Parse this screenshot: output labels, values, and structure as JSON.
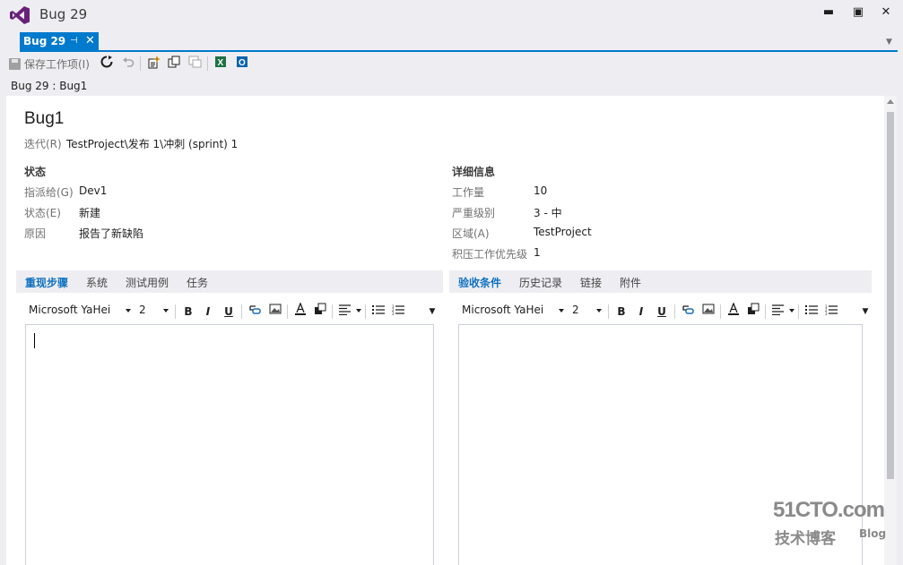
{
  "window": {
    "title": "Bug 29",
    "minimize": "▬",
    "maximize": "▣",
    "close": "✕"
  },
  "tab": {
    "label": "Bug 29",
    "pin": "⊣",
    "close": "✕",
    "overflow": "▼"
  },
  "toolbar": {
    "save_label": "保存工作项(I)",
    "icons": [
      "save-icon",
      "refresh-icon",
      "undo-icon",
      "new-linked-icon",
      "copy-icon",
      "email-icon",
      "excel-icon",
      "outlook-icon"
    ]
  },
  "breadcrumb": "Bug 29 : Bug1",
  "work_item": {
    "title": "Bug1",
    "iteration_label": "迭代(R)",
    "iteration_value": "TestProject\\发布 1\\冲刺 (sprint) 1"
  },
  "status_section": {
    "title": "状态",
    "fields": [
      {
        "label": "指派给(G)",
        "value": "Dev1"
      },
      {
        "label": "状态(E)",
        "value": "新建"
      },
      {
        "label": "原因",
        "value": "报告了新缺陷"
      }
    ]
  },
  "details_section": {
    "title": "详细信息",
    "fields": [
      {
        "label": "工作量",
        "value": "10"
      },
      {
        "label": "严重级别",
        "value": "3 - 中"
      },
      {
        "label": "区域(A)",
        "value": "TestProject"
      },
      {
        "label": "积压工作优先级",
        "value": "1"
      }
    ]
  },
  "left_tabs": [
    "重现步骤",
    "系统",
    "测试用例",
    "任务"
  ],
  "right_tabs": [
    "验收条件",
    "历史记录",
    "链接",
    "附件"
  ],
  "editor_toolbar": {
    "font": "Microsoft YaHei",
    "size": "2",
    "bold": "B",
    "italic": "I",
    "underline": "U"
  },
  "colors": {
    "accent": "#007acc",
    "active_subtab": "#0e70c0",
    "chrome": "#eeeef2",
    "vs_purple": "#68217a"
  },
  "watermark": {
    "site": "51CTO.com",
    "tagline": "技术博客",
    "blog": "Blog"
  }
}
